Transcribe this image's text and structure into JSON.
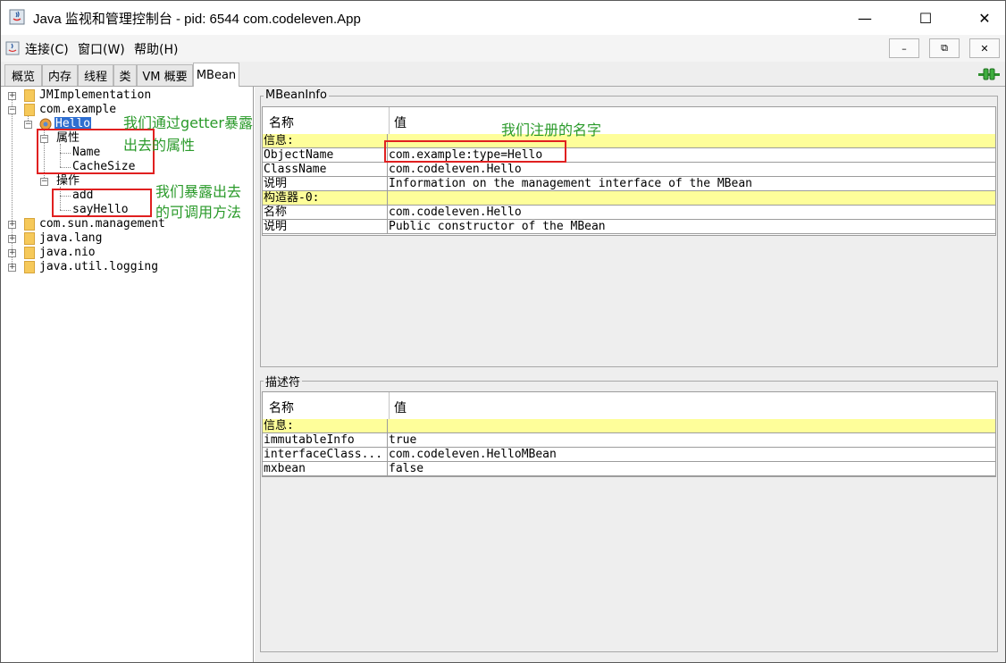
{
  "window": {
    "title": "Java 监视和管理控制台 - pid: 6544 com.codeleven.App",
    "min_glyph": "—",
    "max_glyph": "☐",
    "close_glyph": "✕"
  },
  "menu": {
    "items": [
      "连接(C)",
      "窗口(W)",
      "帮助(H)"
    ],
    "mdi_min": "–",
    "mdi_restore": "⧉",
    "mdi_close": "✕"
  },
  "tabs": {
    "items": [
      "概览",
      "内存",
      "线程",
      "类",
      "VM 概要",
      "MBean"
    ],
    "active": "MBean"
  },
  "tree": {
    "nodes": {
      "jmimpl": "JMImplementation",
      "com_example": "com.example",
      "hello": "Hello",
      "attributes": "属性",
      "attr_name": "Name",
      "attr_cachesize": "CacheSize",
      "operations": "操作",
      "op_add": "add",
      "op_sayhello": "sayHello",
      "com_sun_mgmt": "com.sun.management",
      "java_lang": "java.lang",
      "java_nio": "java.nio",
      "java_util_logging": "java.util.logging"
    },
    "expander_plus": "+",
    "expander_minus": "−"
  },
  "annotations": {
    "getter_line1": "我们通过getter暴露",
    "getter_line2": "出去的属性",
    "ops_line1": "我们暴露出去",
    "ops_line2": "的可调用方法",
    "registered_name": "我们注册的名字"
  },
  "mbeaninfo": {
    "label": "MBeanInfo",
    "col_name": "名称",
    "col_value": "值",
    "rows": [
      {
        "name": "信息:",
        "value": "",
        "section": true
      },
      {
        "name": "ObjectName",
        "value": "com.example:type=Hello",
        "section": false
      },
      {
        "name": "ClassName",
        "value": "com.codeleven.Hello",
        "section": false
      },
      {
        "name": "说明",
        "value": "Information on the management interface of the MBean",
        "section": false
      },
      {
        "name": "构造器-0:",
        "value": "",
        "section": true
      },
      {
        "name": "名称",
        "value": "com.codeleven.Hello",
        "section": false
      },
      {
        "name": "说明",
        "value": "Public constructor of the MBean",
        "section": false
      }
    ]
  },
  "descriptor": {
    "label": "描述符",
    "col_name": "名称",
    "col_value": "值",
    "rows": [
      {
        "name": "信息:",
        "value": "",
        "section": true
      },
      {
        "name": "immutableInfo",
        "value": "true",
        "section": false
      },
      {
        "name": "interfaceClass...",
        "value": "com.codeleven.HelloMBean",
        "section": false
      },
      {
        "name": "mxbean",
        "value": "false",
        "section": false
      }
    ]
  },
  "colors": {
    "annotation_red": "#e02020",
    "annotation_green": "#2a9a2a",
    "section_yellow": "#fefe9a",
    "selection_blue": "#2f6fd0"
  }
}
